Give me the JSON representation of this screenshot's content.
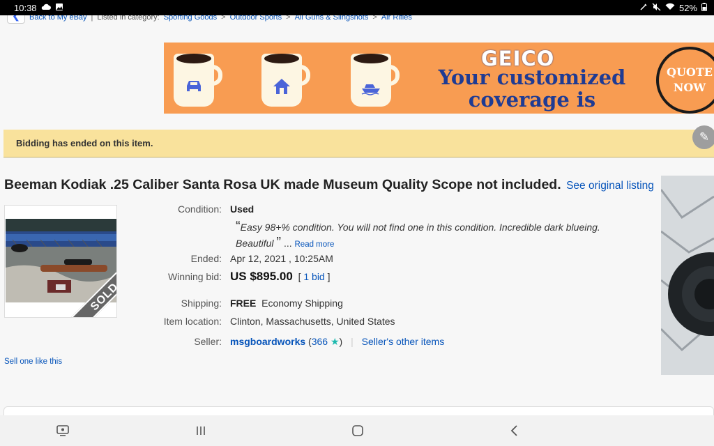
{
  "status_bar": {
    "time": "10:38",
    "battery": "52%",
    "icons_left": [
      "cloud-icon",
      "image-icon"
    ],
    "icons_right": [
      "pen-off-icon",
      "mute-icon",
      "wifi-icon",
      "battery-icon"
    ]
  },
  "breadcrumb": {
    "back_to_my_ebay": "Back to My eBay",
    "listed_in": "Listed in category:",
    "items": [
      "Sporting Goods",
      "Outdoor Sports",
      "All Guns & Slingshots",
      "Air Rifles"
    ],
    "separator": ">"
  },
  "ad": {
    "brand": "GEICO",
    "headline_line1": "Your customized",
    "headline_line2": "coverage is ready",
    "cta_line1": "QUOTE",
    "cta_line2": "NOW",
    "mug_icons": [
      "car-icon",
      "home-icon",
      "boat-icon"
    ],
    "background_color": "#f89c52",
    "text_color": "#1f3b93"
  },
  "notice": {
    "text": "Bidding has ended on this item."
  },
  "listing": {
    "title": "Beeman Kodiak .25 Caliber Santa Rosa UK made Museum Quality Scope not included.",
    "see_original": "See original listing",
    "sold_badge": "SOLD",
    "sell_one_like_this": "Sell one like this",
    "condition_label": "Condition:",
    "condition_value": "Used",
    "quote_open": "“",
    "quote_close": "”",
    "quote_text_line1": "Easy 98+% condition. You will not find one in this condition. Incredible dark blueing.",
    "quote_text_line2": "Beautiful",
    "ellipsis": "...",
    "read_more": "Read more",
    "ended_label": "Ended:",
    "ended_value": "Apr 12, 2021 , 10:25AM",
    "winning_bid_label": "Winning bid:",
    "winning_bid_value": "US $895.00",
    "bids": "1 bid",
    "shipping_label": "Shipping:",
    "shipping_free": "FREE",
    "shipping_method": "Economy Shipping",
    "location_label": "Item location:",
    "location_value": "Clinton, Massachusetts, United States",
    "seller_label": "Seller:",
    "seller_name": "msgboardworks",
    "seller_feedback": "366",
    "sellers_other_items": "Seller's other items"
  },
  "nav_bar": {
    "buttons": [
      "screenshot-icon",
      "recent-apps-icon",
      "home-icon",
      "back-icon"
    ]
  }
}
